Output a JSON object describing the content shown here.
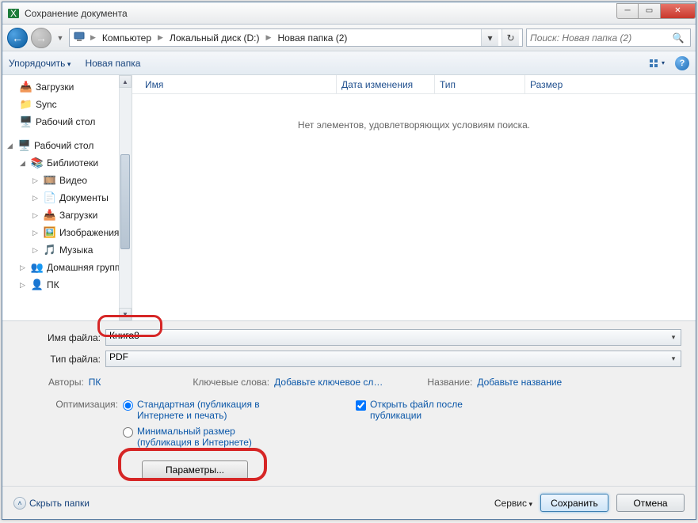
{
  "titlebar": {
    "title": "Сохранение документа"
  },
  "breadcrumbs": [
    "Компьютер",
    "Локальный диск (D:)",
    "Новая папка (2)"
  ],
  "search": {
    "placeholder": "Поиск: Новая папка (2)"
  },
  "toolbar": {
    "organize": "Упорядочить",
    "newfolder": "Новая папка"
  },
  "columns": {
    "name": "Имя",
    "date": "Дата изменения",
    "type": "Тип",
    "size": "Размер"
  },
  "empty": "Нет элементов, удовлетворяющих условиям поиска.",
  "tree": {
    "downloads": "Загрузки",
    "sync": "Sync",
    "desktop1": "Рабочий стол",
    "desktop2": "Рабочий стол",
    "libraries": "Библиотеки",
    "video": "Видео",
    "documents": "Документы",
    "downloads2": "Загрузки",
    "images": "Изображения",
    "music": "Музыка",
    "homegroup": "Домашняя групп",
    "pc": "ПК"
  },
  "form": {
    "filename_label": "Имя файла:",
    "filename_value": "Книга8",
    "filetype_label": "Тип файла:",
    "filetype_value": "PDF",
    "authors_label": "Авторы:",
    "authors_value": "ПК",
    "keywords_label": "Ключевые слова:",
    "keywords_link": "Добавьте ключевое сл…",
    "title_label": "Название:",
    "title_link": "Добавьте название",
    "optimization_label": "Оптимизация:",
    "radio_standard": "Стандартная (публикация в Интернете и печать)",
    "radio_minimal": "Минимальный размер (публикация в Интернете)",
    "chk_open": "Открыть файл после публикации",
    "params_btn": "Параметры..."
  },
  "footer": {
    "hide_folders": "Скрыть папки",
    "tools": "Сервис",
    "save": "Сохранить",
    "cancel": "Отмена"
  }
}
